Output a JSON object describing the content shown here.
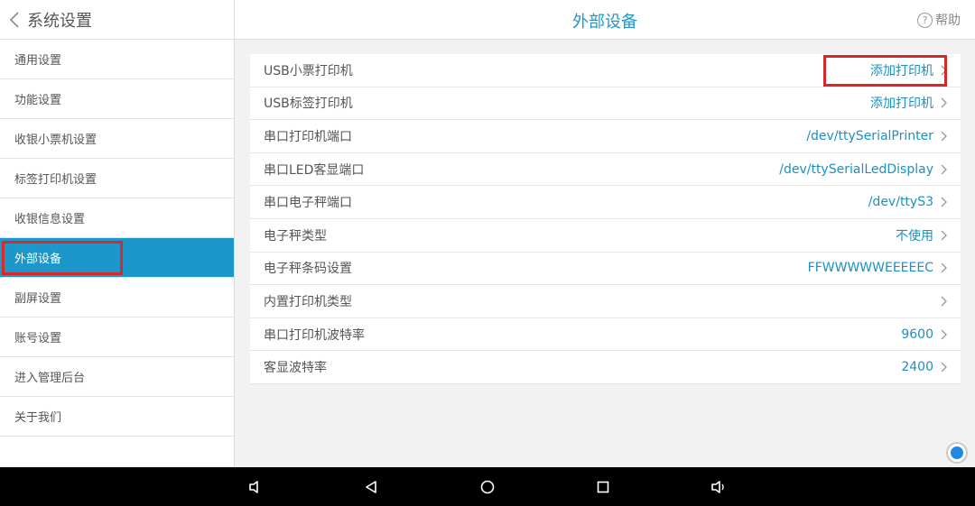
{
  "sidebar": {
    "title": "系统设置",
    "items": [
      {
        "label": "通用设置"
      },
      {
        "label": "功能设置"
      },
      {
        "label": "收银小票机设置"
      },
      {
        "label": "标签打印机设置"
      },
      {
        "label": "收银信息设置"
      },
      {
        "label": "外部设备",
        "active": true
      },
      {
        "label": "副屏设置"
      },
      {
        "label": "账号设置"
      },
      {
        "label": "进入管理后台"
      },
      {
        "label": "关于我们"
      }
    ]
  },
  "header": {
    "title": "外部设备",
    "help_label": "帮助",
    "help_icon_glyph": "?"
  },
  "settings": [
    {
      "label": "USB小票打印机",
      "value": "添加打印机",
      "highlighted": true
    },
    {
      "label": "USB标签打印机",
      "value": "添加打印机"
    },
    {
      "label": "串口打印机端口",
      "value": "/dev/ttySerialPrinter"
    },
    {
      "label": "串口LED客显端口",
      "value": "/dev/ttySerialLedDisplay"
    },
    {
      "label": "串口电子秤端口",
      "value": "/dev/ttyS3"
    },
    {
      "label": "电子秤类型",
      "value": "不使用"
    },
    {
      "label": "电子秤条码设置",
      "value": "FFWWWWWEEEEEC"
    },
    {
      "label": "内置打印机类型",
      "value": ""
    },
    {
      "label": "串口打印机波特率",
      "value": "9600"
    },
    {
      "label": "客显波特率",
      "value": "2400"
    }
  ],
  "colors": {
    "accent": "#1d97c9",
    "highlight": "#d62a2a"
  },
  "icons": {
    "back": "chevron-left-icon",
    "help": "question-circle-icon",
    "row_chevron": "chevron-right-icon",
    "float": "assistive-touch-icon",
    "system_nav": [
      "volume-down-icon",
      "back-triangle-icon",
      "home-circle-icon",
      "recents-square-icon",
      "volume-up-icon"
    ]
  }
}
